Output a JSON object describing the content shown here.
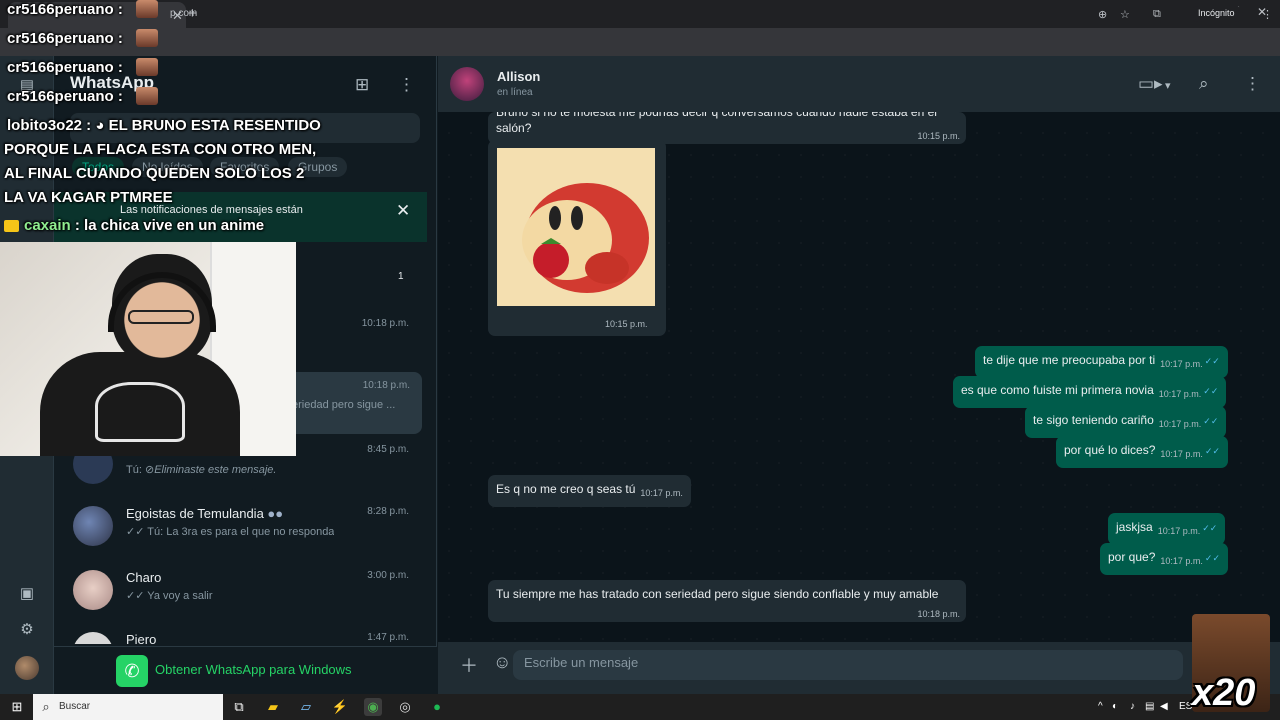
{
  "browser": {
    "url": "web.whatsapp.com",
    "url_prefix": "cr",
    "url_visible": "p.com",
    "incognito_label": "Incógnito"
  },
  "sidebar": {
    "title": "WhatsApp",
    "filters": [
      "Todos",
      "No leídos",
      "Favoritos",
      "Grupos"
    ],
    "notification_banner": "Las notificaciones de mensajes están",
    "unread_count": "1",
    "get_app_label": "Obtener WhatsApp para Windows",
    "chats": [
      {
        "name": "",
        "time": "10:18 p.m.",
        "message": ""
      },
      {
        "name": "",
        "time": "10:18 p.m.",
        "message": "eriedad pero sigue ..."
      },
      {
        "name": "",
        "time": "8:45 p.m.",
        "message_prefix": "Tú:",
        "message": "Eliminaste este mensaje."
      },
      {
        "name": "Egoistas de Temulandia",
        "time": "8:28 p.m.",
        "message": "Tú: La 3ra es para el que no responda"
      },
      {
        "name": "Charo",
        "time": "3:00 p.m.",
        "message": "Ya voy a salir"
      },
      {
        "name": "Piero",
        "time": "1:47 p.m.",
        "message": ""
      }
    ]
  },
  "chat": {
    "contact_name": "Allison",
    "status": "en línea",
    "composer_placeholder": "Escribe un mensaje",
    "messages": [
      {
        "dir": "in",
        "text": "Bruno si no te molesta me podrías decir q conversamos cuando nadie estaba en el salón?",
        "time": "10:15 p.m."
      },
      {
        "dir": "in",
        "type": "image",
        "time": "10:15 p.m."
      },
      {
        "dir": "out",
        "text": "te dije que me preocupaba por ti",
        "time": "10:17 p.m."
      },
      {
        "dir": "out",
        "text": "es que como fuiste mi primera novia",
        "time": "10:17 p.m."
      },
      {
        "dir": "out",
        "text": "te sigo teniendo cariño",
        "time": "10:17 p.m."
      },
      {
        "dir": "out",
        "text": "por qué lo dices?",
        "time": "10:17 p.m."
      },
      {
        "dir": "in",
        "text": "Es q no me creo q seas tú",
        "time": "10:17 p.m."
      },
      {
        "dir": "out",
        "text": "jaskjsa",
        "time": "10:17 p.m."
      },
      {
        "dir": "out",
        "text": "por que?",
        "time": "10:17 p.m."
      },
      {
        "dir": "in",
        "text": "Tu siempre me has tratado con seriedad pero sigue siendo confiable y muy amable",
        "time": "10:18 p.m."
      }
    ]
  },
  "taskbar": {
    "search_label": "Buscar",
    "lang": "ESP"
  },
  "overlay": {
    "chat_lines": [
      {
        "user": "cr5166peruano",
        "text": ""
      },
      {
        "user": "cr5166peruano",
        "text": ""
      },
      {
        "user": "cr5166peruano",
        "text": ""
      },
      {
        "user": "cr5166peruano",
        "text": ""
      },
      {
        "user": "lobito3o22",
        "text": "EL BRUNO ESTA RESENTIDO"
      },
      {
        "user": "",
        "text": "PORQUE LA FLACA ESTA CON OTRO MEN,"
      },
      {
        "user": "",
        "text": "AL FINAL CUANDO QUEDEN SOLO LOS 2"
      },
      {
        "user": "",
        "text": "LA VA KAGAR PTMREE"
      },
      {
        "user": "caxain",
        "text": "la chica vive en un anime"
      }
    ],
    "multiplier": "x20"
  },
  "colors": {
    "accent": "#00a884",
    "outgoing_bubble": "#005c4b",
    "incoming_bubble": "#202c33",
    "background": "#0b141a"
  }
}
